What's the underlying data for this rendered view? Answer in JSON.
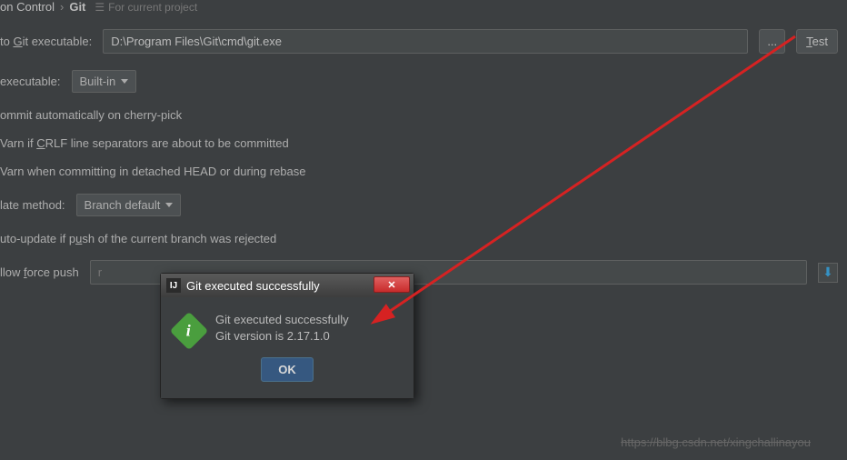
{
  "header": {
    "crumb1": "on Control",
    "crumb2": "Git",
    "subtitle": "For current project"
  },
  "git_path": {
    "label_prefix": "to ",
    "label_mid": "G",
    "label_suffix": "it executable:",
    "value": "D:\\Program Files\\Git\\cmd\\git.exe",
    "browse": "...",
    "test_t": "T",
    "test_suffix": "est"
  },
  "ssh": {
    "label": "executable:",
    "value": "Built-in"
  },
  "checks": {
    "cherry": "ommit automatically on cherry-pick",
    "crlf_pre": "Varn if ",
    "crlf_u": "C",
    "crlf_suf": "RLF line separators are about to be committed",
    "detached": "Varn when committing in detached HEAD or during rebase"
  },
  "update": {
    "label": "late method:",
    "value": "Branch default"
  },
  "auto": {
    "pre": "uto-update if p",
    "u": "u",
    "suf": "sh of the current branch was rejected"
  },
  "force": {
    "label_pre": "llow ",
    "label_u": "f",
    "label_suf": "orce push",
    "placeholder": "r"
  },
  "dialog": {
    "title": "Git executed successfully",
    "line1": "Git executed successfully",
    "line2": "Git version is 2.17.1.0",
    "ok": "OK"
  },
  "watermark": "https://blbg.csdn.net/xingchallinayou"
}
